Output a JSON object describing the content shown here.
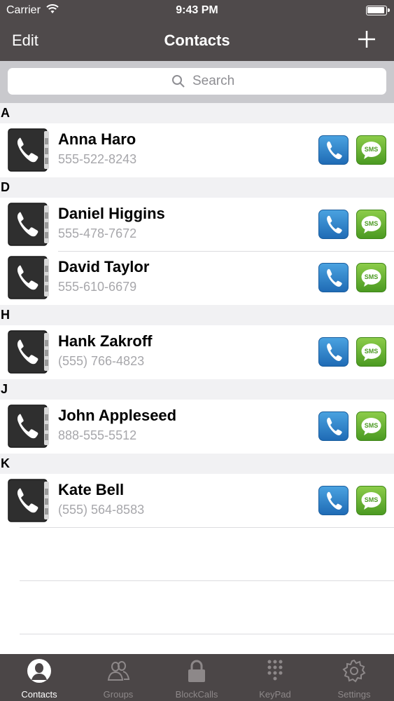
{
  "status_bar": {
    "carrier": "Carrier",
    "time": "9:43 PM"
  },
  "nav": {
    "edit_label": "Edit",
    "title": "Contacts",
    "add_icon": "plus-icon"
  },
  "search": {
    "placeholder": "Search"
  },
  "sections": [
    {
      "letter": "A",
      "contacts": [
        {
          "name": "Anna Haro",
          "phone": "555-522-8243"
        }
      ]
    },
    {
      "letter": "D",
      "contacts": [
        {
          "name": "Daniel Higgins",
          "phone": "555-478-7672"
        },
        {
          "name": "David Taylor",
          "phone": "555-610-6679"
        }
      ]
    },
    {
      "letter": "H",
      "contacts": [
        {
          "name": "Hank Zakroff",
          "phone": "(555) 766-4823"
        }
      ]
    },
    {
      "letter": "J",
      "contacts": [
        {
          "name": "John Appleseed",
          "phone": "888-555-5512"
        }
      ]
    },
    {
      "letter": "K",
      "contacts": [
        {
          "name": "Kate Bell",
          "phone": "(555) 564-8583"
        }
      ]
    }
  ],
  "sms_label": "SMS",
  "tabs": [
    {
      "label": "Contacts",
      "icon": "person-icon",
      "active": true
    },
    {
      "label": "Groups",
      "icon": "group-icon",
      "active": false
    },
    {
      "label": "BlockCalls",
      "icon": "lock-icon",
      "active": false
    },
    {
      "label": "KeyPad",
      "icon": "keypad-icon",
      "active": false
    },
    {
      "label": "Settings",
      "icon": "gear-icon",
      "active": false
    }
  ],
  "colors": {
    "header": "#4f4a4b",
    "tabbar": "#4b4647",
    "call_button": "#2a7cc7",
    "sms_button": "#62ab30"
  }
}
